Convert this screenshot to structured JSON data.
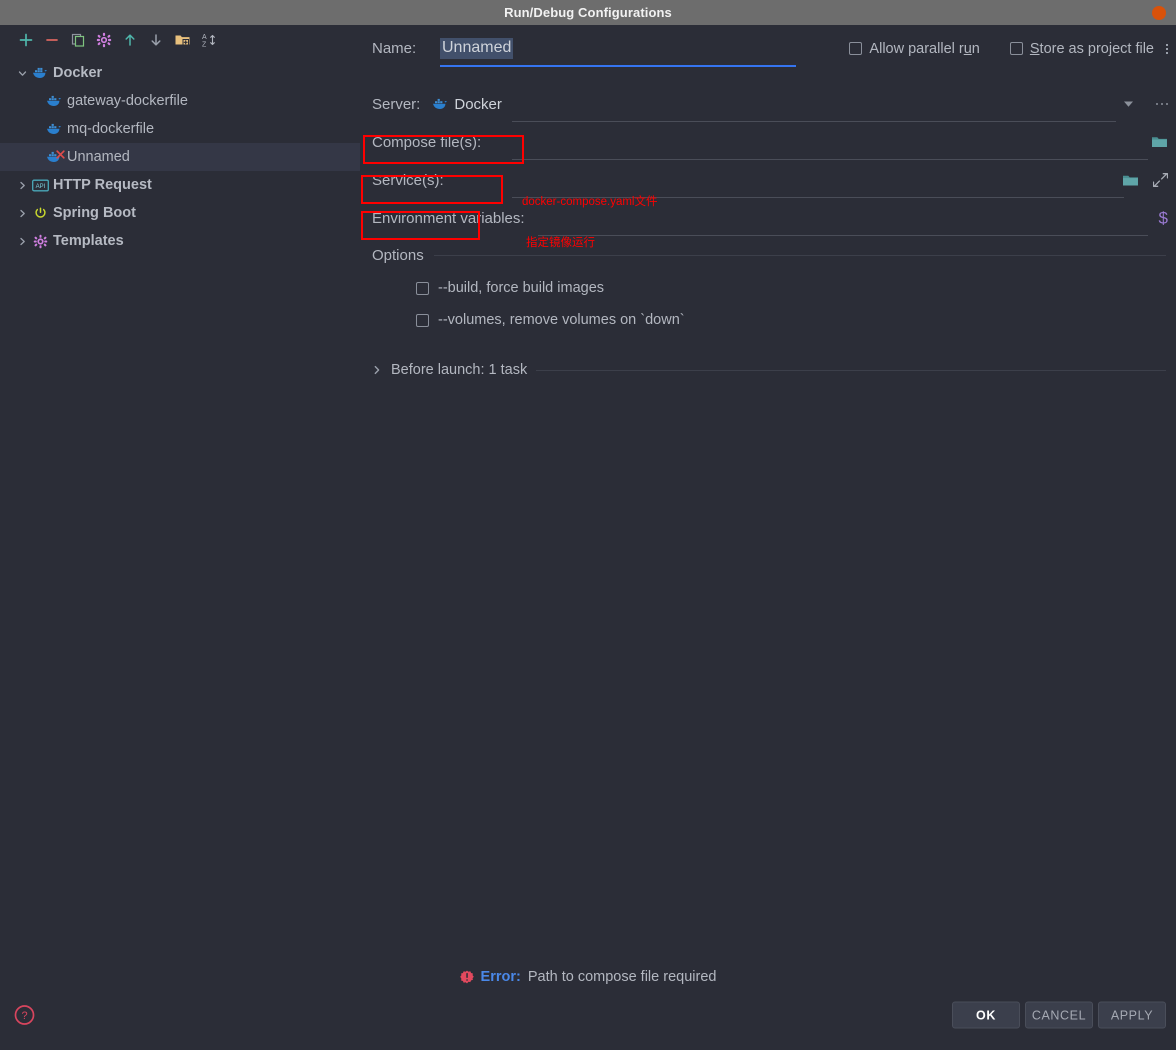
{
  "window": {
    "title": "Run/Debug Configurations",
    "close_icon": "close-circle-icon"
  },
  "sidebar": {
    "toolbar": [
      {
        "name": "add-configuration-button",
        "icon": "plus-icon",
        "color": "#4fb6ab"
      },
      {
        "name": "remove-configuration-button",
        "icon": "minus-icon",
        "color": "#d9655f"
      },
      {
        "name": "copy-configuration-button",
        "icon": "copy-icon",
        "color": "#7fc47f"
      },
      {
        "name": "edit-templates-button",
        "icon": "gear-icon",
        "color": "#d07fe0"
      },
      {
        "name": "move-up-button",
        "icon": "arrow-up-icon",
        "color": "#4fb6ab"
      },
      {
        "name": "move-down-button",
        "icon": "arrow-down-icon",
        "color": "#9aa0ab"
      },
      {
        "name": "new-folder-button",
        "icon": "folder-add-icon",
        "color": "#e8c07d"
      },
      {
        "name": "sort-alphabetically-button",
        "icon": "sort-az-icon",
        "color": "#b3b7c0"
      }
    ],
    "tree": [
      {
        "label": "Docker",
        "icon": "docker-whale-icon",
        "level": 0,
        "expanded": true,
        "selected": false,
        "error": false
      },
      {
        "label": "gateway-dockerfile",
        "icon": "docker-whale-icon",
        "level": 1,
        "expanded": null,
        "selected": false,
        "error": false
      },
      {
        "label": "mq-dockerfile",
        "icon": "docker-whale-icon",
        "level": 1,
        "expanded": null,
        "selected": false,
        "error": false
      },
      {
        "label": "Unnamed",
        "icon": "docker-whale-icon",
        "level": 1,
        "expanded": null,
        "selected": true,
        "error": true
      },
      {
        "label": "HTTP Request",
        "icon": "http-request-icon",
        "level": 0,
        "expanded": false,
        "selected": false,
        "error": false
      },
      {
        "label": "Spring Boot",
        "icon": "spring-boot-icon",
        "level": 0,
        "expanded": false,
        "selected": false,
        "error": false
      },
      {
        "label": "Templates",
        "icon": "gear-icon",
        "level": 0,
        "expanded": false,
        "selected": false,
        "error": false
      }
    ]
  },
  "form": {
    "name_label": "Name:",
    "name_value": "Unnamed",
    "allow_parallel_run_label": "Allow parallel run",
    "allow_parallel_run_checked": false,
    "store_as_project_file_label": "Store as project file",
    "store_as_project_file_checked": false,
    "server_label": "Server:",
    "server_value": "Docker",
    "compose_files_label": "Compose file(s):",
    "compose_files_value": "",
    "services_label": "Service(s):",
    "services_value": "",
    "env_vars_label": "Environment variables:",
    "env_vars_value": "",
    "options_title": "Options",
    "options": [
      {
        "label": "--build, force build images",
        "checked": false
      },
      {
        "label": "--volumes, remove volumes on `down`",
        "checked": false
      }
    ],
    "before_launch_label": "Before launch: 1 task",
    "before_launch_expanded": false
  },
  "annotations": [
    {
      "text": "docker-compose.yaml文件",
      "color": "#ff0000"
    },
    {
      "text": "指定镜像运行",
      "color": "#ff0000"
    }
  ],
  "status": {
    "error_icon": "error-badge-icon",
    "error_label": "Error:",
    "error_message": "Path to compose file required"
  },
  "footer": {
    "help_icon": "help-circle-icon",
    "ok_label": "OK",
    "cancel_label": "CANCEL",
    "apply_label": "APPLY"
  },
  "colors": {
    "background": "#2b2d37",
    "titlebar": "#6d6d6d",
    "selection": "#343746",
    "accent_blue": "#3574f0",
    "annotation_red": "#ff0000",
    "close_orange": "#d8520a"
  }
}
